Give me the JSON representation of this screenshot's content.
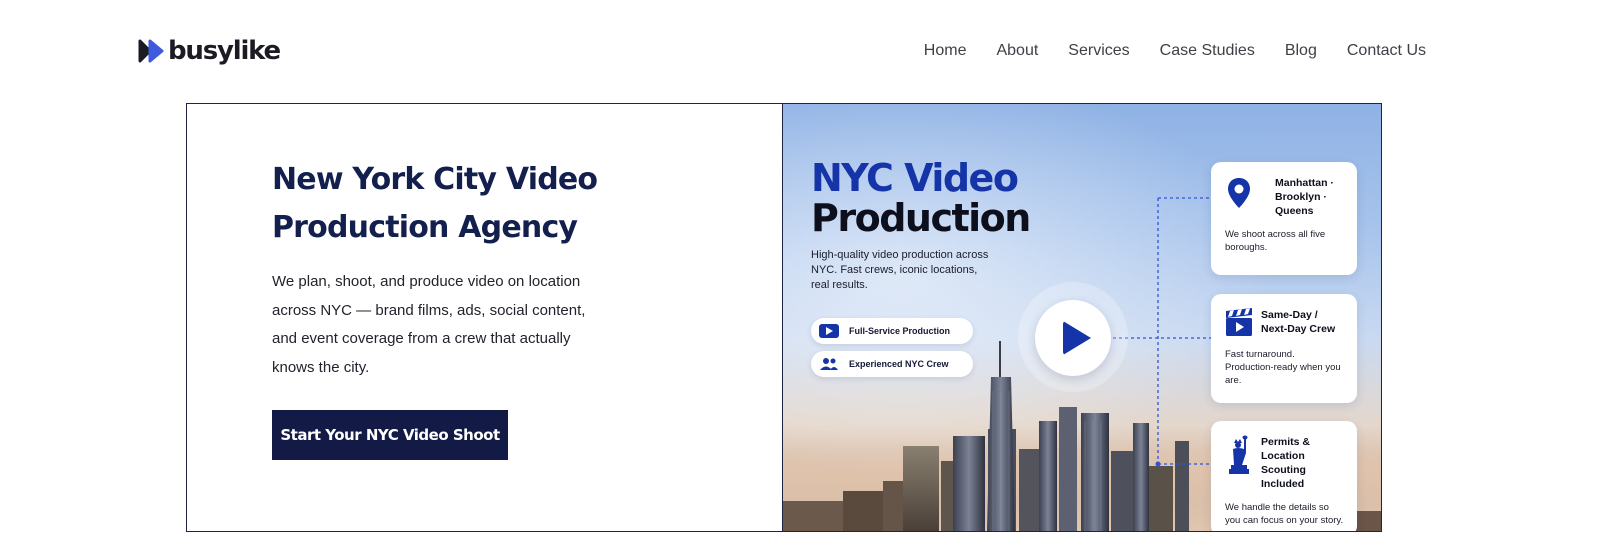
{
  "brand": {
    "name": "busylike"
  },
  "nav": {
    "items": [
      "Home",
      "About",
      "Services",
      "Case Studies",
      "Blog",
      "Contact Us"
    ]
  },
  "hero": {
    "title": "New York City Video Production Agency",
    "description": "We plan, shoot, and produce video on location across NYC — brand films, ads, social content, and event coverage from a crew that actually knows the city.",
    "cta_label": "Start Your NYC Video Shoot"
  },
  "visual": {
    "title_line1": "NYC Video",
    "title_line2": "Production",
    "description": "High-quality video production across NYC. Fast crews, iconic locations, real results.",
    "pills": [
      {
        "label": "Full-Service Production",
        "icon": "video-icon"
      },
      {
        "label": "Experienced NYC Crew",
        "icon": "people-icon"
      }
    ],
    "cards": [
      {
        "title": "Manhattan · Brooklyn · Queens",
        "text": "We shoot across all five boroughs.",
        "icon": "location-pin-icon"
      },
      {
        "title": "Same-Day / Next-Day Crew",
        "text": "Fast turnaround. Production-ready when you are.",
        "icon": "clapperboard-icon"
      },
      {
        "title": "Permits & Location Scouting Included",
        "text": "We handle the details so you can focus on your story.",
        "icon": "statue-of-liberty-icon"
      }
    ]
  },
  "colors": {
    "navy": "#121a45",
    "accent_blue": "#1434a8",
    "heading": "#13204d"
  }
}
